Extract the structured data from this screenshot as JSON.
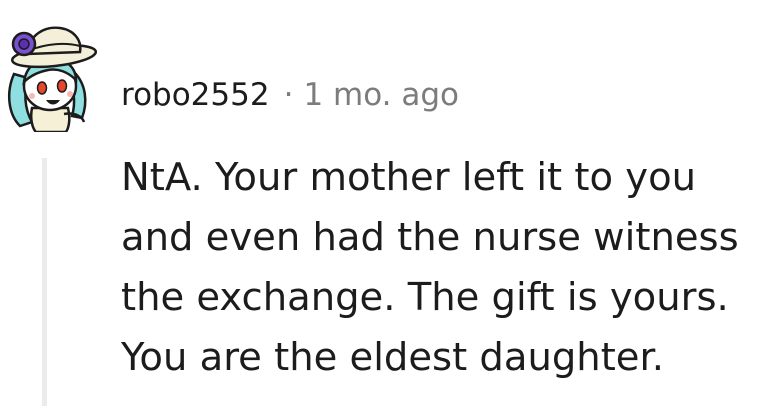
{
  "comment": {
    "author": "robo2552",
    "separator": "·",
    "timestamp": "1 mo. ago",
    "avatar_icon": "snoo-avatar-icon",
    "body": "NtA. Your mother left it to you\nand even had the nurse witness\nthe exchange. The gift is yours.\nYou are the eldest daughter."
  },
  "colors": {
    "text": "#1c1c1c",
    "meta": "#7c7c7c",
    "thread_line": "#ebebeb",
    "avatar_skin": "#ffffff",
    "avatar_hair": "#8fdfe0",
    "avatar_hat": "#f4efd8",
    "avatar_flower": "#7a4fd1",
    "avatar_eyes": "#e8462c"
  }
}
